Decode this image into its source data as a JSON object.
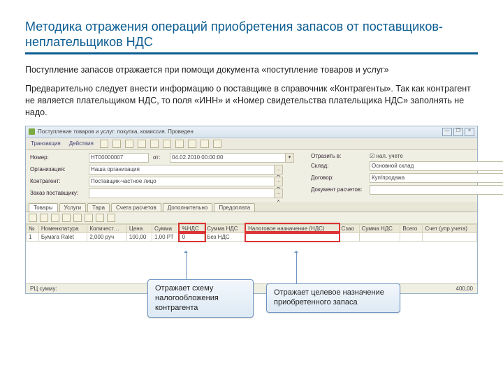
{
  "slide": {
    "title": "Методика отражения операций приобретения запасов от поставщиков-неплательщиков НДС",
    "para1": "Поступление запасов отражается при помощи документа «поступление товаров и услуг»",
    "para2": "Предварительно следует внести информацию о поставщике в справочник «Контрагенты». Так как контрагент не является плательщиком НДС, то поля «ИНН» и «Номер свидетельства плательщика НДС» заполнять не надо."
  },
  "window": {
    "title": "Поступление товаров и услуг: покупка, комиссия. Проведен",
    "close": "×",
    "max": "❐",
    "min": "—"
  },
  "toolbar": {
    "btn1": "Транзакция",
    "btn2": "Действия"
  },
  "form": {
    "l_number": "Номер:",
    "v_number": "НТ00000007",
    "l_date": "от:",
    "v_date": "04.02.2010 00:00:00",
    "l_reflect": "Отразить в:",
    "v_chk1": "нал. учете",
    "l_org": "Организация:",
    "v_org": "Наша организация",
    "l_sklad": "Склад:",
    "v_sklad": "Основной склад",
    "l_contr": "Контрагент:",
    "v_contr": "Поставщик-частное лицо",
    "l_dogovor": "Договор:",
    "v_dogovor": "Куп/продажа",
    "l_document": "Документ расчетов:",
    "v_document": "",
    "l_zakaz": "Заказ поставщику:",
    "v_zakaz": ""
  },
  "tabs": [
    "Товары",
    "Услуги",
    "Тара",
    "Счета расчетов",
    "Дополнительно",
    "Предоплата"
  ],
  "grid": {
    "headers": [
      "№",
      "Номенклатура",
      "Количест…",
      "Цена",
      "Сумма",
      "%НДС",
      "Сумма НДС",
      "Налоговое назначение (НДС)",
      "Сзао",
      "Сумма НДС",
      "Всего",
      "Счет (упр.учета)"
    ],
    "row": [
      "1",
      "Бумага Ralet",
      "2,000 руч",
      "100,00",
      "1,00 РТ",
      "0",
      "Без НДС",
      "",
      "",
      "",
      "",
      ""
    ]
  },
  "callouts": {
    "left": "Отражает схему налогообложения контрагента",
    "right": "Отражает целевое назначение приобретенного запаса"
  },
  "status": {
    "left": "РЦ сумму:",
    "right": "400,00"
  }
}
